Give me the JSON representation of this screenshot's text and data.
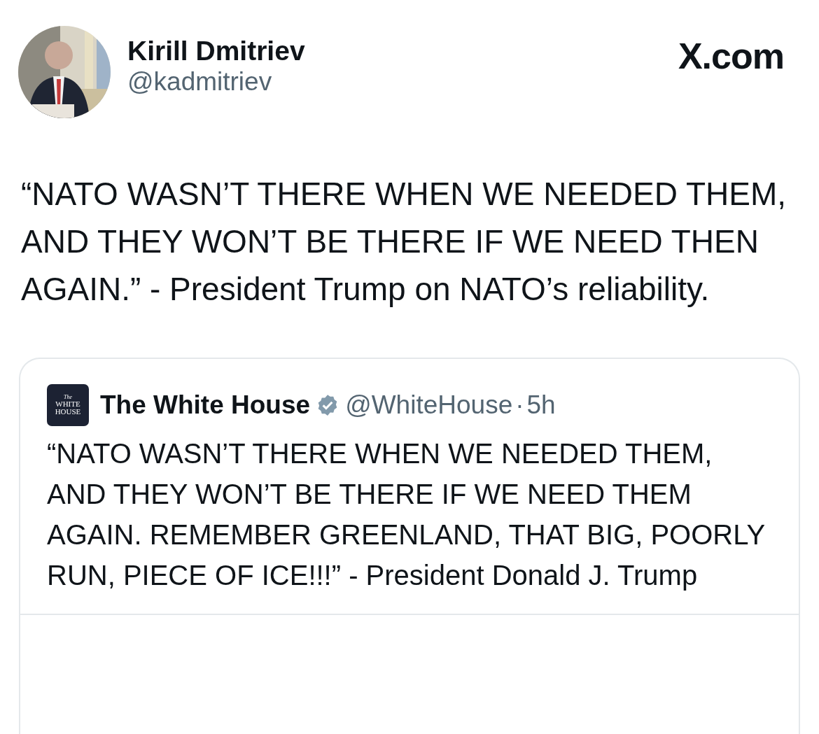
{
  "author": {
    "name": "Kirill Dmitriev",
    "handle": "@kadmitriev"
  },
  "source_label": "X.com",
  "text": "“NATO WASN’T THERE WHEN WE NEEDED THEM, AND THEY WON’T BE THERE IF WE NEED THEN AGAIN.” - President Trump on NATO’s reliability.",
  "quoted": {
    "logo_lines": [
      "The",
      "WHITE",
      "HOUSE"
    ],
    "name": "The White House",
    "verified": true,
    "handle": "@WhiteHouse",
    "separator": "·",
    "time": "5h",
    "text": "“NATO WASN’T THERE WHEN WE NEEDED THEM, AND THEY WON’T BE THERE IF WE NEED THEM AGAIN. REMEMBER GREENLAND, THAT BIG, POORLY RUN, PIECE OF ICE!!!” - President Donald J. Trump"
  }
}
